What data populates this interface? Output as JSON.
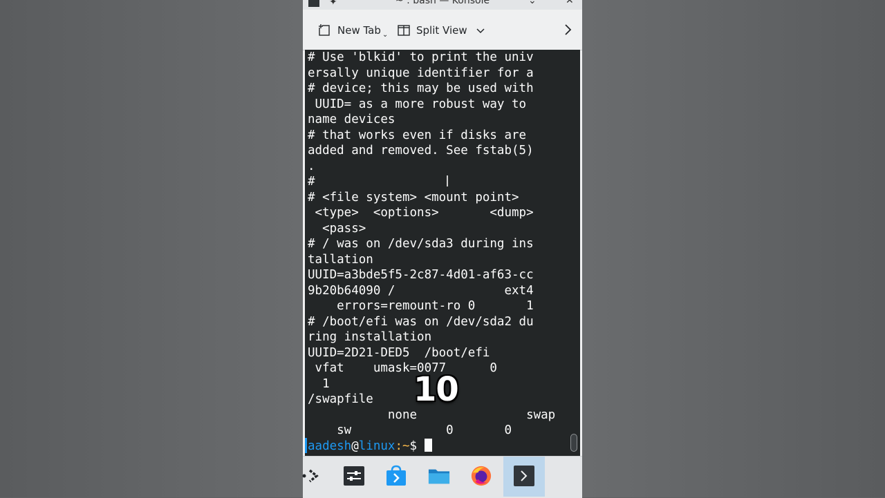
{
  "window": {
    "title": "~ : bash — Konsole",
    "controls": {
      "minimize": "⌄",
      "maximize": "⌃",
      "close": "✕"
    }
  },
  "toolbar": {
    "new_tab_label": "New Tab",
    "split_view_label": "Split View"
  },
  "terminal": {
    "lines": [
      "# Use 'blkid' to print the univ",
      "ersally unique identifier for a",
      "# device; this may be used with",
      " UUID= as a more robust way to",
      "name devices",
      "# that works even if disks are",
      "added and removed. See fstab(5)",
      ".",
      "#",
      "# <file system> <mount point>",
      " <type>  <options>       <dump>",
      "  <pass>",
      "# / was on /dev/sda3 during ins",
      "tallation",
      "UUID=a3bde5f5-2c87-4d01-af63-cc",
      "9b20b64090 /               ext4",
      "    errors=remount-ro 0       1",
      "# /boot/efi was on /dev/sda2 du",
      "ring installation",
      "UUID=2D21-DED5  /boot/efi",
      " vfat    umask=0077      0",
      "  1",
      "/swapfile",
      "           none               swap",
      "    sw             0       0"
    ],
    "prompt": {
      "user": "aadesh",
      "at": "@",
      "host": "linux",
      "path": ":~",
      "dollar": "$ "
    }
  },
  "overlay": {
    "number": "10"
  },
  "taskbar": {
    "items": [
      {
        "icon": "app-launcher-icon"
      },
      {
        "icon": "system-settings-icon"
      },
      {
        "icon": "discover-store-icon"
      },
      {
        "icon": "file-manager-icon"
      },
      {
        "icon": "firefox-icon"
      },
      {
        "icon": "konsole-icon"
      }
    ]
  },
  "colors": {
    "terminal_bg": "#232627",
    "terminal_fg": "#fcfcfc",
    "prompt_user": "#1d99f3",
    "prompt_path": "#fdbc4b",
    "accent": "#1d99f3"
  }
}
